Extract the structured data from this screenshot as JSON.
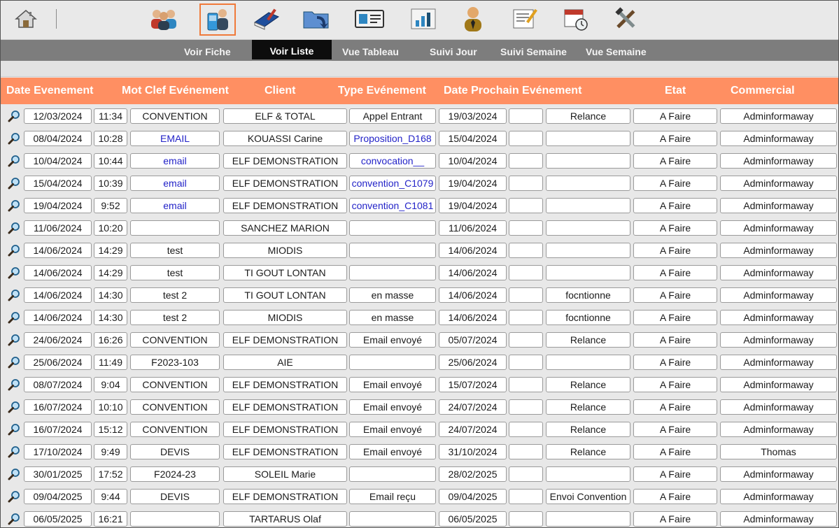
{
  "toolbar": {
    "icons": [
      {
        "name": "home-icon"
      },
      {
        "name": "contacts-group-icon"
      },
      {
        "name": "phone-contact-icon",
        "active": true
      },
      {
        "name": "book-pen-icon"
      },
      {
        "name": "folder-import-icon"
      },
      {
        "name": "id-card-icon"
      },
      {
        "name": "bar-chart-icon"
      },
      {
        "name": "user-icon"
      },
      {
        "name": "edit-document-icon"
      },
      {
        "name": "calendar-clock-icon"
      },
      {
        "name": "tools-icon"
      }
    ]
  },
  "nav": {
    "items": [
      "Voir Fiche",
      "Voir Liste",
      "Vue Tableau",
      "Suivi Jour",
      "Suivi Semaine",
      "Vue Semaine"
    ],
    "active": "Voir Liste"
  },
  "table": {
    "headers": [
      "Date Evenement",
      "Mot Clef Evénement",
      "Client",
      "Type Evénement",
      "Date Prochain Evénement",
      "Etat",
      "Commercial"
    ],
    "rows": [
      {
        "date": "12/03/2024",
        "time": "11:34",
        "keyword": "CONVENTION",
        "client": "ELF & TOTAL",
        "type": "Appel Entrant",
        "next_date": "19/03/2024",
        "next_extra": "",
        "next_type": "Relance",
        "etat": "A Faire",
        "commercial": "Adminformaway"
      },
      {
        "date": "08/04/2024",
        "time": "10:28",
        "keyword": "EMAIL",
        "keyword_link": true,
        "client": "KOUASSI Carine",
        "type": "Proposition_D168",
        "type_link": true,
        "next_date": "15/04/2024",
        "next_extra": "",
        "next_type": "",
        "etat": "A Faire",
        "commercial": "Adminformaway"
      },
      {
        "date": "10/04/2024",
        "time": "10:44",
        "keyword": "email",
        "keyword_link": true,
        "client": "ELF DEMONSTRATION",
        "type": "convocation__",
        "type_link": true,
        "next_date": "10/04/2024",
        "next_extra": "",
        "next_type": "",
        "etat": "A Faire",
        "commercial": "Adminformaway"
      },
      {
        "date": "15/04/2024",
        "time": "10:39",
        "keyword": "email",
        "keyword_link": true,
        "client": "ELF DEMONSTRATION",
        "type": "convention_C1079",
        "type_link": true,
        "next_date": "19/04/2024",
        "next_extra": "",
        "next_type": "",
        "etat": "A Faire",
        "commercial": "Adminformaway"
      },
      {
        "date": "19/04/2024",
        "time": "9:52",
        "keyword": "email",
        "keyword_link": true,
        "client": "ELF DEMONSTRATION",
        "type": "convention_C1081",
        "type_link": true,
        "next_date": "19/04/2024",
        "next_extra": "",
        "next_type": "",
        "etat": "A Faire",
        "commercial": "Adminformaway"
      },
      {
        "date": "11/06/2024",
        "time": "10:20",
        "keyword": "",
        "client": "SANCHEZ MARION",
        "type": "",
        "next_date": "11/06/2024",
        "next_extra": "",
        "next_type": "",
        "etat": "A Faire",
        "commercial": "Adminformaway"
      },
      {
        "date": "14/06/2024",
        "time": "14:29",
        "keyword": "test",
        "client": "MIODIS",
        "type": "",
        "next_date": "14/06/2024",
        "next_extra": "",
        "next_type": "",
        "etat": "A Faire",
        "commercial": "Adminformaway"
      },
      {
        "date": "14/06/2024",
        "time": "14:29",
        "keyword": "test",
        "client": "TI GOUT LONTAN",
        "type": "",
        "next_date": "14/06/2024",
        "next_extra": "",
        "next_type": "",
        "etat": "A Faire",
        "commercial": "Adminformaway"
      },
      {
        "date": "14/06/2024",
        "time": "14:30",
        "keyword": "test 2",
        "client": "TI GOUT LONTAN",
        "type": "en masse",
        "next_date": "14/06/2024",
        "next_extra": "",
        "next_type": "focntionne",
        "etat": "A Faire",
        "commercial": "Adminformaway"
      },
      {
        "date": "14/06/2024",
        "time": "14:30",
        "keyword": "test 2",
        "client": "MIODIS",
        "type": "en masse",
        "next_date": "14/06/2024",
        "next_extra": "",
        "next_type": "focntionne",
        "etat": "A Faire",
        "commercial": "Adminformaway"
      },
      {
        "date": "24/06/2024",
        "time": "16:26",
        "keyword": "CONVENTION",
        "client": "ELF DEMONSTRATION",
        "type": "Email envoyé",
        "next_date": "05/07/2024",
        "next_extra": "",
        "next_type": "Relance",
        "etat": "A Faire",
        "commercial": "Adminformaway"
      },
      {
        "date": "25/06/2024",
        "time": "11:49",
        "keyword": "F2023-103",
        "client": "AIE",
        "type": "",
        "next_date": "25/06/2024",
        "next_extra": "",
        "next_type": "",
        "etat": "A Faire",
        "commercial": "Adminformaway"
      },
      {
        "date": "08/07/2024",
        "time": "9:04",
        "keyword": "CONVENTION",
        "client": "ELF DEMONSTRATION",
        "type": "Email envoyé",
        "next_date": "15/07/2024",
        "next_extra": "",
        "next_type": "Relance",
        "etat": "A Faire",
        "commercial": "Adminformaway"
      },
      {
        "date": "16/07/2024",
        "time": "10:10",
        "keyword": "CONVENTION",
        "client": "ELF DEMONSTRATION",
        "type": "Email envoyé",
        "next_date": "24/07/2024",
        "next_extra": "",
        "next_type": "Relance",
        "etat": "A Faire",
        "commercial": "Adminformaway"
      },
      {
        "date": "16/07/2024",
        "time": "15:12",
        "keyword": "CONVENTION",
        "client": "ELF DEMONSTRATION",
        "type": "Email envoyé",
        "next_date": "24/07/2024",
        "next_extra": "",
        "next_type": "Relance",
        "etat": "A Faire",
        "commercial": "Adminformaway"
      },
      {
        "date": "17/10/2024",
        "time": "9:49",
        "keyword": "DEVIS",
        "client": "ELF DEMONSTRATION",
        "type": "Email envoyé",
        "next_date": "31/10/2024",
        "next_extra": "",
        "next_type": "Relance",
        "etat": "A Faire",
        "commercial": "Thomas"
      },
      {
        "date": "30/01/2025",
        "time": "17:52",
        "keyword": "F2024-23",
        "client": "SOLEIL Marie",
        "type": "",
        "next_date": "28/02/2025",
        "next_extra": "",
        "next_type": "",
        "etat": "A Faire",
        "commercial": "Adminformaway"
      },
      {
        "date": "09/04/2025",
        "time": "9:44",
        "keyword": "DEVIS",
        "client": "ELF DEMONSTRATION",
        "type": "Email reçu",
        "next_date": "09/04/2025",
        "next_extra": "",
        "next_type": "Envoi Convention",
        "etat": "A Faire",
        "commercial": "Adminformaway"
      },
      {
        "date": "06/05/2025",
        "time": "16:21",
        "keyword": "",
        "client": "TARTARUS Olaf",
        "type": "",
        "next_date": "06/05/2025",
        "next_extra": "",
        "next_type": "",
        "etat": "A Faire",
        "commercial": "Adminformaway"
      }
    ]
  }
}
